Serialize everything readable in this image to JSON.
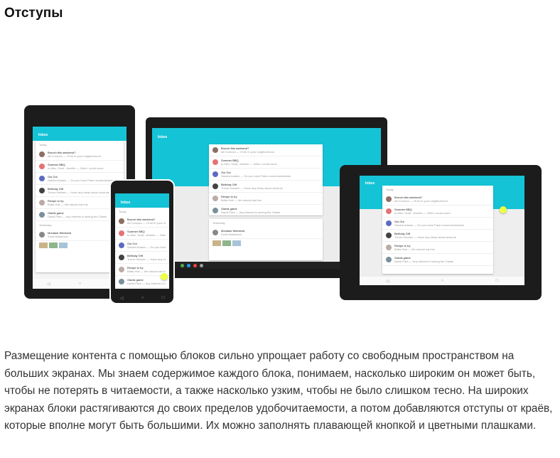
{
  "heading": "Отступы",
  "body_text": "Размещение контента с помощью блоков сильно упрощает работу со свободным пространством на больших экранах. Мы знаем содержимое каждого блока, понимаем, насколько широким он может быть, чтобы не потерять в читаемости, а также насколько узким, чтобы не было слишком тесно. На широких экранах блоки растягиваются до своих пределов удобочитаемости, а потом добавляются отступы от краёв, которые вполне могут быть большими. Их можно заполнять плавающей кнопкой и цветными плашками.",
  "mockup": {
    "app_title": "Inbox",
    "section_today": "Today",
    "section_yesterday": "Yesterday",
    "items": [
      {
        "title": "Brunch this weekend?",
        "sub": "Ali Connors — I'll be in your neighborhood"
      },
      {
        "title": "Summer BBQ",
        "sub": "to Alex, Scott, Jennifer — Wish I could come"
      },
      {
        "title": "Oui Oui",
        "sub": "Sandra Adams — Do you have Paris recommendations"
      },
      {
        "title": "Birthday Gift",
        "sub": "Trevor Hansen — Have any ideas about what we"
      },
      {
        "title": "Recipe to try",
        "sub": "Britta Holt — We should eat this"
      },
      {
        "title": "Giants game",
        "sub": "David Park — Any interest in seeing the Giants"
      }
    ],
    "yesterday_item": {
      "title": "Montauk Weekend",
      "sub": "Scott Masterson"
    },
    "colors": {
      "accent": "#15c3d6",
      "fab": "#eeff41"
    }
  }
}
